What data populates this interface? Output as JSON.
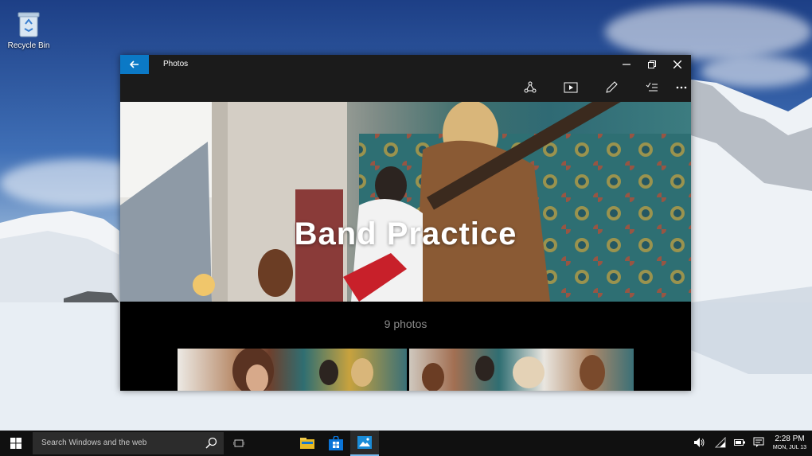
{
  "desktop": {
    "recycle_bin_label": "Recycle Bin"
  },
  "window": {
    "title": "Photos",
    "back_icon": "back-arrow-icon",
    "minimize_icon": "minimize-icon",
    "restore_icon": "restore-icon",
    "close_icon": "close-icon",
    "commands": [
      "share-icon",
      "slideshow-icon",
      "edit-icon",
      "select-icon",
      "more-icon"
    ],
    "album": {
      "title": "Band Practice",
      "count": "9 photos"
    },
    "accent": "#0b79c6"
  },
  "taskbar": {
    "search_placeholder": "Search Windows and the web",
    "apps": [
      "file-explorer-icon",
      "store-icon",
      "photos-icon"
    ],
    "active_app": "photos-icon",
    "tray_icons": [
      "volume-icon",
      "network-icon",
      "battery-icon",
      "notifications-icon"
    ],
    "time": "2:28 PM",
    "date": "MON, JUL 13"
  }
}
